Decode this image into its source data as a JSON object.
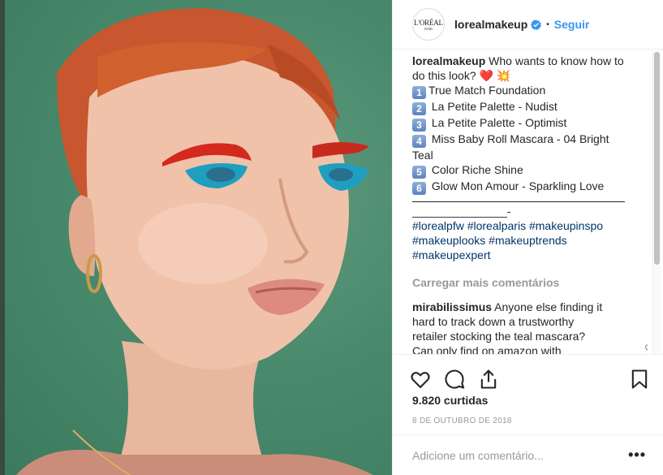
{
  "post": {
    "image_alt": "Model with red-orange hair, red and teal eye makeup",
    "brand_logo_text": "L'ORÉAL",
    "brand_logo_sub": "PARIS"
  },
  "header": {
    "username": "lorealmakeup",
    "separator": "•",
    "follow_label": "Seguir"
  },
  "caption": {
    "username": "lorealmakeup",
    "text_line1": " Who wants to know how to",
    "text_line2": "do this look? ",
    "heart": "❤️",
    "boom": "💥",
    "items": [
      {
        "num": "1",
        "label": "True Match Foundation"
      },
      {
        "num": "2",
        "label": " La Petite Palette - Nudist"
      },
      {
        "num": "3",
        "label": " La Petite Palette - Optimist"
      },
      {
        "num": "4",
        "label": " Miss Baby Roll Mascara - 04 Bright"
      },
      {
        "num": "5",
        "label": " Color Riche Shine"
      },
      {
        "num": "6",
        "label": " Glow Mon Amour - Sparkling Love"
      }
    ],
    "item4_cont": "Teal",
    "dash_line": "_______________-",
    "hashtags_line1": "#lorealpfw #lorealparis #makeupinspo",
    "hashtags_line2": "#makeuplooks #makeuptrends",
    "hashtags_line3": "#makeupexpert"
  },
  "load_more_label": "Carregar mais comentários",
  "comment": {
    "username": "mirabilissimus",
    "line1": " Anyone else finding it",
    "line2": "hard to track down a trustworthy",
    "line3": "retailer stocking the teal mascara?",
    "line4": "Can only find on amazon with"
  },
  "actions": {
    "like_icon": "heart-icon",
    "comment_icon": "comment-icon",
    "share_icon": "share-icon",
    "save_icon": "bookmark-icon"
  },
  "likes_text": "9.820 curtidas",
  "date_text": "8 DE OUTUBRO DE 2018",
  "add_comment_placeholder": "Adicione um comentário...",
  "more_label": "•••",
  "colors": {
    "link": "#3897f0",
    "hashtag": "#003569",
    "muted": "#999999"
  }
}
